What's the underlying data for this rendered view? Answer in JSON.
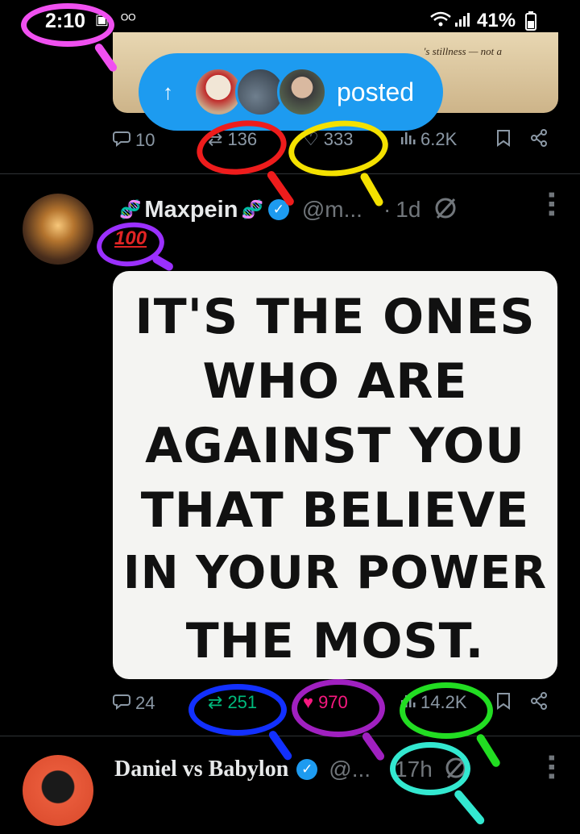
{
  "status_bar": {
    "time": "2:10",
    "battery": "41%"
  },
  "previous_tweet": {
    "image_caption": "'s stillness — not a",
    "posted_pill": {
      "label": "posted"
    },
    "actions": {
      "replies": "10",
      "reposts": "136",
      "likes": "333",
      "views": "6.2K"
    }
  },
  "tweet_main": {
    "author_name": "Maxpein",
    "handle": "@m...",
    "separator": "·",
    "age": "1d",
    "emoji_badge": "100",
    "quote_lines": [
      "IT'S THE ONES",
      "WHO ARE",
      "AGAINST YOU",
      "THAT BELIEVE",
      "IN YOUR POWER",
      "THE MOST."
    ],
    "actions": {
      "replies": "24",
      "reposts": "251",
      "likes": "970",
      "views": "14.2K"
    }
  },
  "tweet_next": {
    "author_name": "Daniel vs Babylon",
    "handle": "@...",
    "age": "17h"
  },
  "colors": {
    "background": "#000000",
    "accent_blue": "#1d9bf0",
    "repost_green": "#00ba7c",
    "like_pink": "#f91880",
    "muted": "#8b98a5"
  },
  "icons": [
    "reply-icon",
    "repost-icon",
    "like-icon",
    "views-icon",
    "bookmark-icon",
    "share-icon",
    "verified-badge-icon",
    "grok-icon",
    "more-icon",
    "up-arrow-icon",
    "wifi-icon",
    "signal-icon",
    "battery-icon"
  ]
}
